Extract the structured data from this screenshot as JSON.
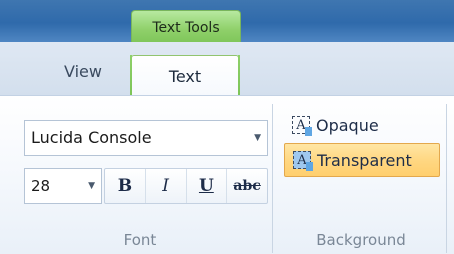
{
  "ribbon": {
    "contextual_group": "Text Tools",
    "tabs": [
      {
        "label": "View",
        "active": false
      },
      {
        "label": "Text",
        "active": true
      }
    ]
  },
  "font_group": {
    "label": "Font",
    "font_name": "Lucida Console",
    "font_size": "28",
    "formatting": {
      "bold": "B",
      "italic": "I",
      "underline": "U",
      "strikethrough": "abc"
    }
  },
  "background_group": {
    "label": "Background",
    "options": [
      {
        "label": "Opaque",
        "selected": false,
        "icon": "opaque-background-icon"
      },
      {
        "label": "Transparent",
        "selected": true,
        "icon": "transparent-background-icon"
      }
    ]
  },
  "colors": {
    "title_bar": "#2f6aab",
    "contextual_tab": "#8fd06a",
    "selected_highlight": "#ffd680",
    "ribbon_background": "#f6f9fd"
  }
}
